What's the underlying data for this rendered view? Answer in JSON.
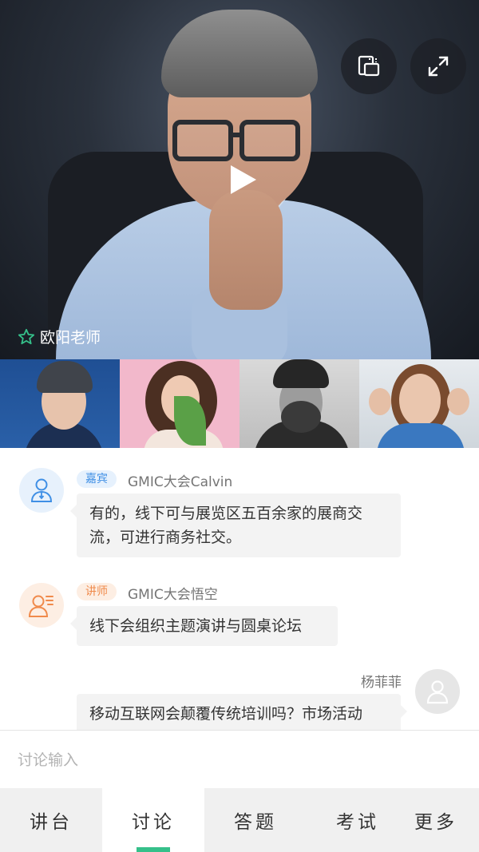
{
  "video": {
    "teacher_name": "欧阳老师",
    "buttons": [
      {
        "icon": "screen-switch-icon"
      },
      {
        "icon": "fullscreen-icon"
      }
    ],
    "play_icon": "play-icon",
    "star_icon": "star-outline-icon"
  },
  "thumbnails": [
    {
      "icon": "participant-video-1"
    },
    {
      "icon": "participant-video-2"
    },
    {
      "icon": "participant-video-3"
    },
    {
      "icon": "participant-video-4"
    }
  ],
  "messages": [
    {
      "role": "嘉宾",
      "sender": "GMIC大会Calvin",
      "lines": [
        "有的，线下可与展览区五百余家的展商交",
        "流，可进行商务社交。"
      ],
      "avatar_icon": "guest-user-icon"
    },
    {
      "role": "讲师",
      "sender": "GMIC大会悟空",
      "lines": [
        "线下会组织主题演讲与圆桌论坛"
      ],
      "avatar_icon": "lecturer-user-icon"
    },
    {
      "role": "",
      "sender": "杨菲菲",
      "lines": [
        "移动互联网会颠覆传统培训吗？市场活动"
      ],
      "avatar_icon": "default-user-icon"
    }
  ],
  "input": {
    "placeholder": "讨论输入"
  },
  "tabs": [
    {
      "label": "讲台",
      "active": false
    },
    {
      "label": "讨论",
      "active": true
    },
    {
      "label": "答题",
      "active": false
    },
    {
      "label": "考试",
      "active": false
    },
    {
      "label": "更多",
      "active": false
    }
  ],
  "colors": {
    "accent": "#35c08a",
    "guest_badge": "#3f8fe5",
    "lecturer_badge": "#f08a4b",
    "bubble_bg": "#f3f3f3"
  }
}
